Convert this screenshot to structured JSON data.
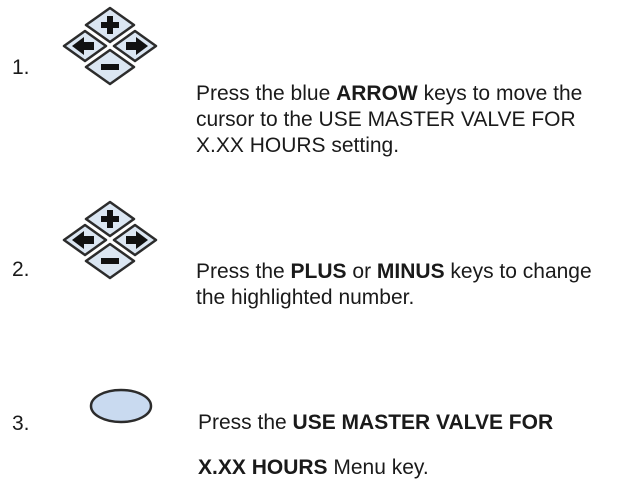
{
  "steps": [
    {
      "number": "1.",
      "icon": "arrow-keypad-icon",
      "parts": [
        "Press the blue ",
        "ARROW",
        "  keys to move the cursor to the USE MASTER VALVE FOR X.XX HOURS setting."
      ]
    },
    {
      "number": "2.",
      "icon": "arrow-keypad-icon",
      "parts": [
        "Press the ",
        "PLUS",
        " or ",
        "MINUS",
        " keys to change the highlighted number."
      ]
    },
    {
      "number": "3.",
      "icon": "oval-menu-key-icon",
      "parts": [
        "Press the ",
        "USE MASTER VALVE FOR",
        "X.XX HOURS",
        " Menu key."
      ]
    }
  ],
  "colors": {
    "key_fill": "#dbe6f2",
    "key_stroke": "#2c2c2c",
    "menu_key_fill": "#c9daf0"
  }
}
